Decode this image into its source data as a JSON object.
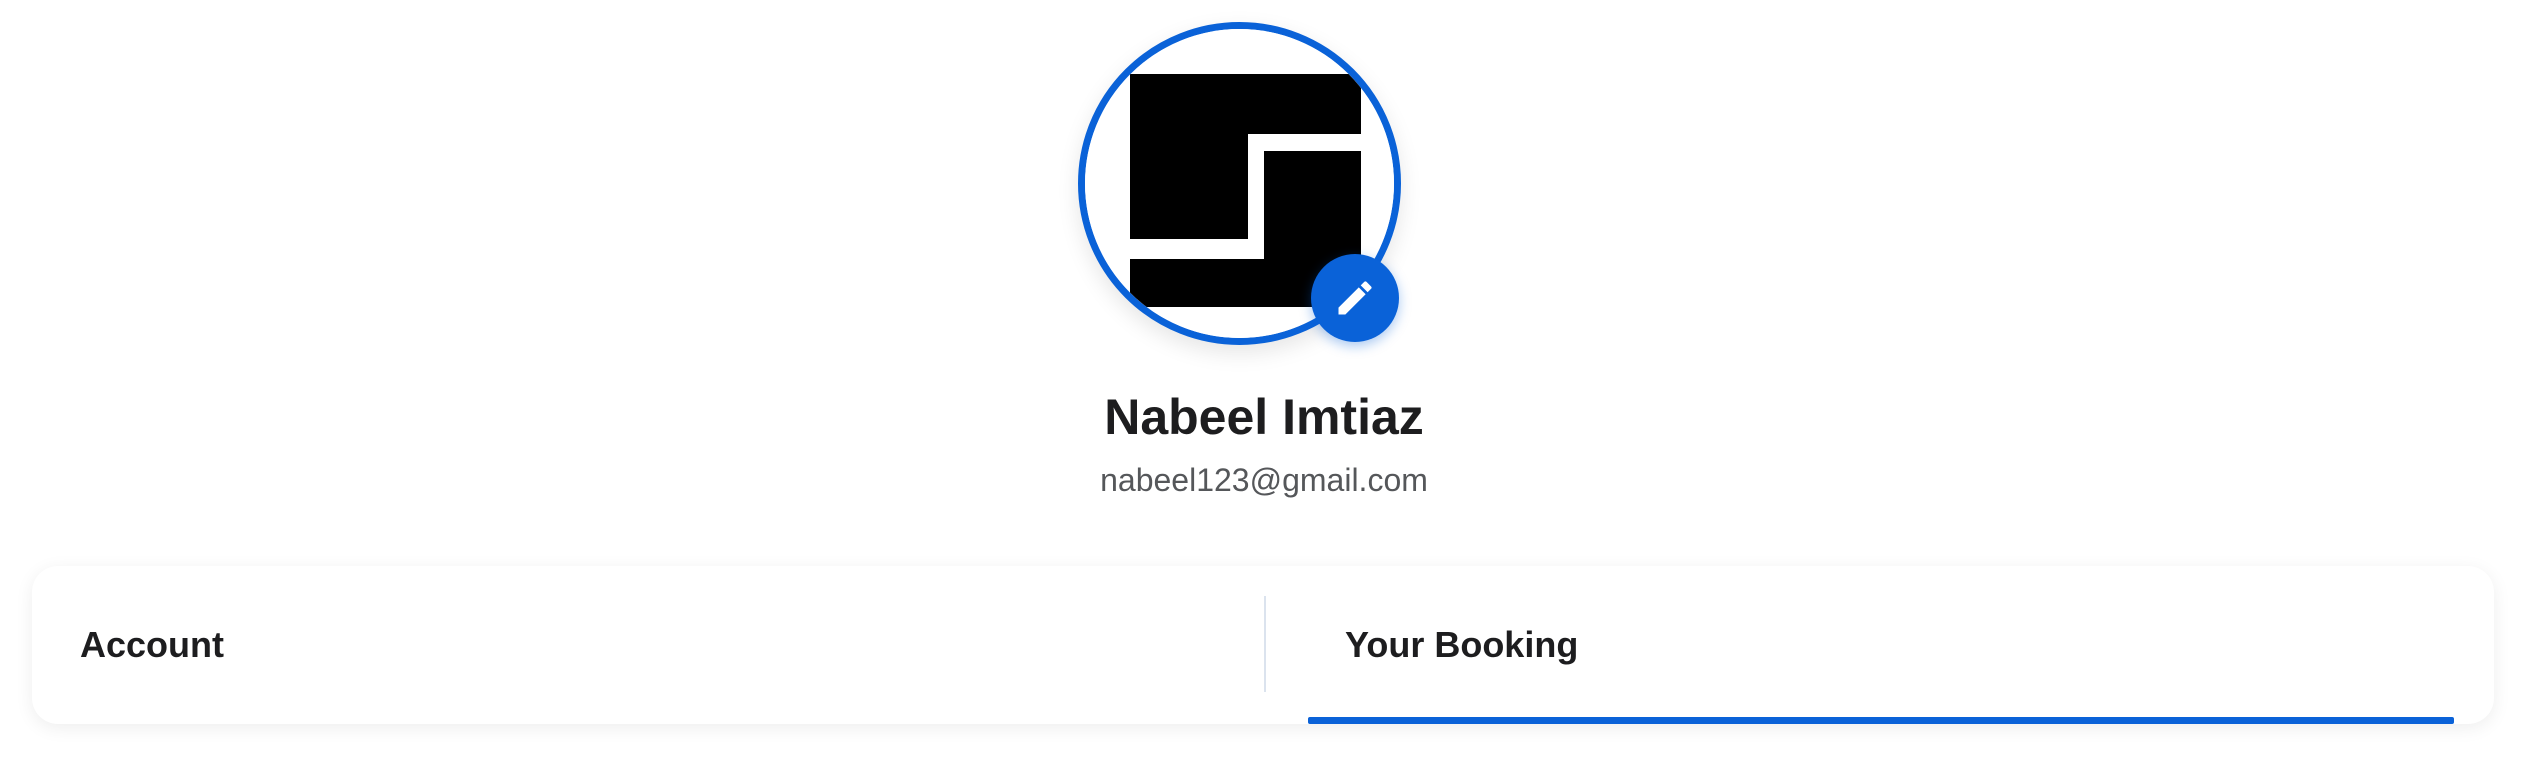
{
  "profile": {
    "name": "Nabeel Imtiaz",
    "email": "nabeel123@gmail.com",
    "avatar_icon": "logo-avatar-image",
    "edit_icon": "pencil-icon"
  },
  "tabs": [
    {
      "label": "Account",
      "active": false
    },
    {
      "label": "Your Booking",
      "active": true
    }
  ],
  "colors": {
    "accent": "#0a62d8",
    "text_primary": "#1d1d1f",
    "text_secondary": "#55575a",
    "background": "#ffffff"
  }
}
